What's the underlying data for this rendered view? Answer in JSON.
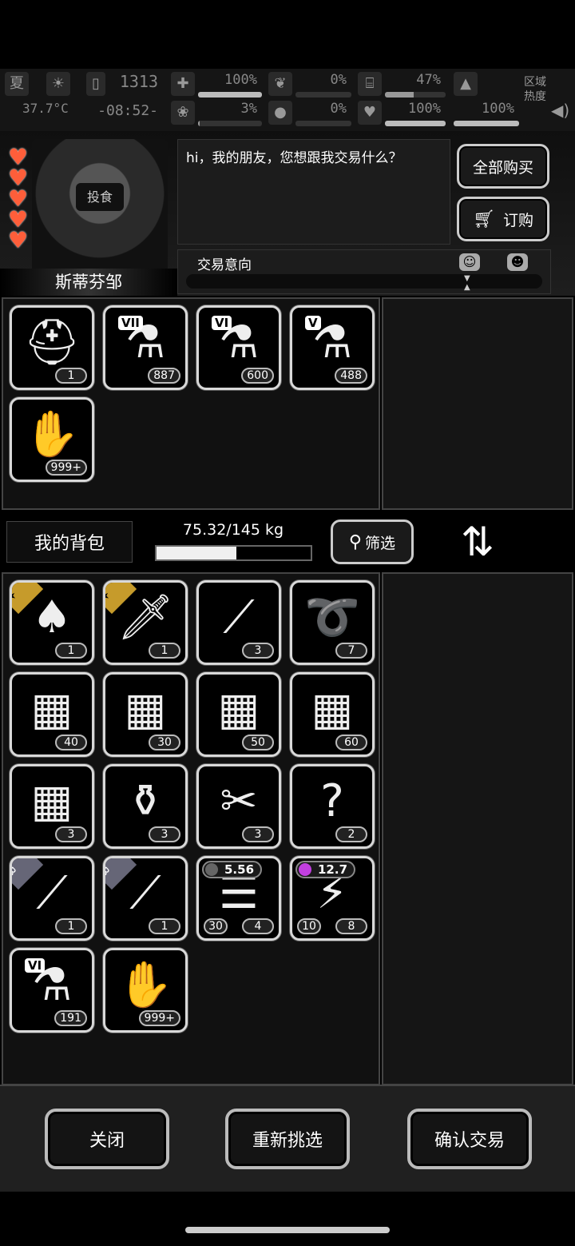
{
  "status": {
    "season": "夏",
    "temperature": "37.7°C",
    "clock_top": "1313",
    "clock_bottom": "-08:52-",
    "stats": [
      {
        "name": "health",
        "value": "100%",
        "fill": 1.0,
        "trend": "up"
      },
      {
        "name": "stomach",
        "value": "0%",
        "fill": 0.0,
        "trend": "down"
      },
      {
        "name": "drink",
        "value": "47%",
        "fill": 0.47,
        "trend": "down"
      },
      {
        "name": "mood",
        "value": "3%",
        "fill": 0.03,
        "trend": "none"
      },
      {
        "name": "blood",
        "value": "0%",
        "fill": 0.0,
        "trend": "down"
      },
      {
        "name": "heart",
        "value": "100%",
        "fill": 1.0,
        "trend": "up"
      },
      {
        "name": "stamina",
        "value": "100%",
        "fill": 1.0,
        "trend": "up"
      }
    ],
    "zone_label": "区域热度"
  },
  "npc": {
    "name": "斯蒂芬邹",
    "mask_text": "投食",
    "hearts": 5,
    "dialog": "hi，我的朋友，您想跟我交易什么？",
    "buy_all_label": "全部购买",
    "order_label": "订购",
    "intent_label": "交易意向"
  },
  "trader_items": [
    {
      "icon": "helmet",
      "count": "1"
    },
    {
      "icon": "vial",
      "roman": "VII",
      "count": "887"
    },
    {
      "icon": "vial",
      "roman": "VI",
      "count": "600"
    },
    {
      "icon": "vial",
      "roman": "V",
      "count": "488"
    },
    {
      "icon": "zombie-card",
      "count": "999+"
    }
  ],
  "bag": {
    "title": "我的背包",
    "weight": "75.32/145 kg",
    "weight_fill": 0.52,
    "filter_label": "筛选"
  },
  "bag_items": [
    {
      "icon": "shovel",
      "count": "1",
      "badge": "star"
    },
    {
      "icon": "machete",
      "count": "1",
      "badge": "star"
    },
    {
      "icon": "lockpick",
      "count": "3"
    },
    {
      "icon": "rope",
      "count": "7"
    },
    {
      "icon": "crate",
      "count": "40"
    },
    {
      "icon": "crate",
      "count": "30"
    },
    {
      "icon": "crate",
      "count": "50"
    },
    {
      "icon": "crate",
      "count": "60"
    },
    {
      "icon": "crate",
      "count": "3"
    },
    {
      "icon": "spray-cans",
      "count": "3"
    },
    {
      "icon": "bandage",
      "count": "3"
    },
    {
      "icon": "manual",
      "count": "2"
    },
    {
      "icon": "katana",
      "count": "1",
      "badge": "B"
    },
    {
      "icon": "katana",
      "count": "1",
      "badge": "B"
    },
    {
      "icon": "magazine",
      "count": "4",
      "count2": "30",
      "topval": "5.56"
    },
    {
      "icon": "backpack",
      "count": "8",
      "count2": "10",
      "topval": "12.7",
      "topval_color": "purple"
    },
    {
      "icon": "vial",
      "roman": "VI",
      "count": "191"
    },
    {
      "icon": "zombie-card",
      "count": "999+"
    }
  ],
  "actions": {
    "close": "关闭",
    "reselect": "重新挑选",
    "confirm": "确认交易"
  },
  "colors": {
    "heart": "#ff5e3a",
    "star_badge": "#c69b2b",
    "trend_up": "#3ba54a",
    "trend_down": "#c0392b"
  }
}
